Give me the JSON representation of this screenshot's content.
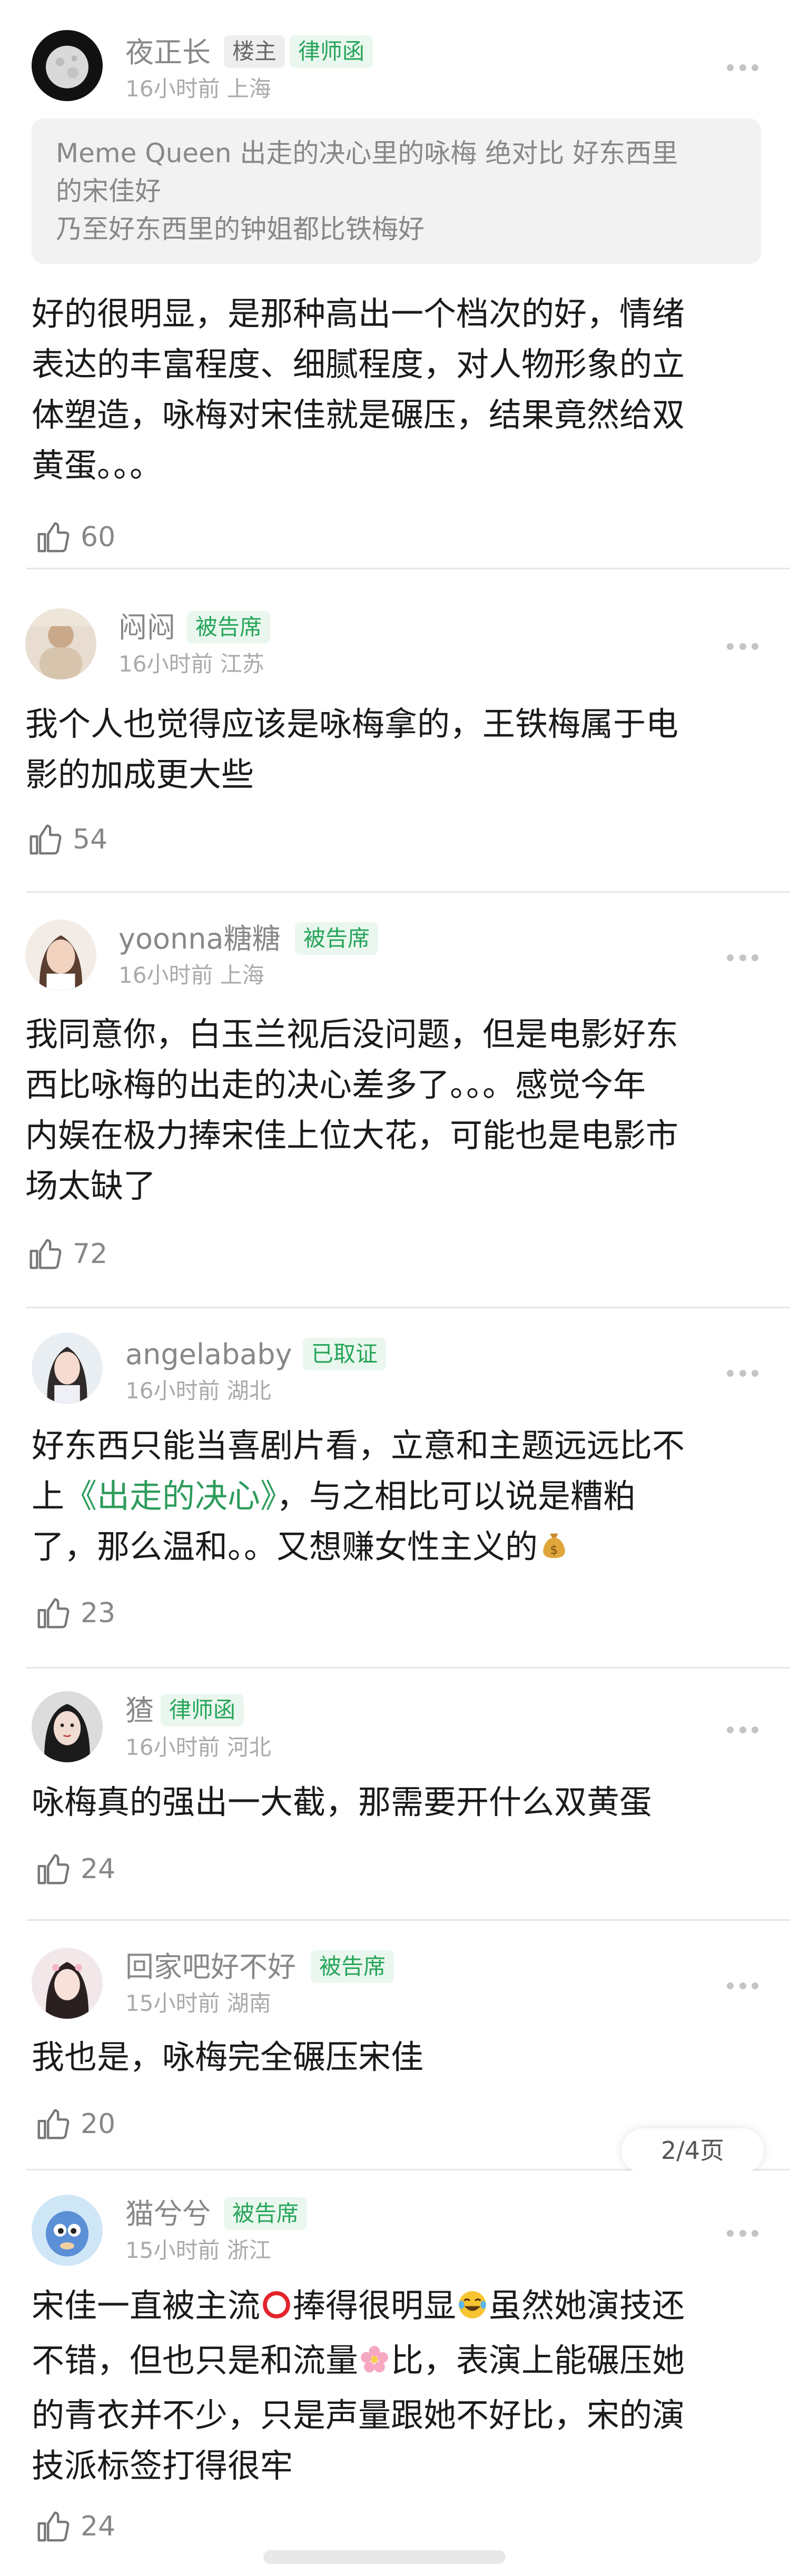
{
  "comments": [
    {
      "name": "夜正长",
      "badges": [
        "楼主",
        "律师函"
      ],
      "meta": "16小时前 上海",
      "quote_lines": [
        "Meme Queen 出走的决心里的咏梅 绝对比 好东西里",
        "的宋佳好",
        "乃至好东西里的钟姐都比铁梅好"
      ],
      "text_lines": [
        "好的很明显，是那种高出一个档次的好，情绪",
        "表达的丰富程度、细腻程度，对人物形象的立",
        "体塑造，咏梅对宋佳就是碾压，结果竟然给双",
        "黄蛋。。。"
      ],
      "likes": "60"
    },
    {
      "name": "闷闷",
      "badges": [
        "被告席"
      ],
      "meta": "16小时前 江苏",
      "text_lines": [
        "我个人也觉得应该是咏梅拿的，王铁梅属于电",
        "影的加成更大些"
      ],
      "likes": "54"
    },
    {
      "name": "yoonna糖糖",
      "badges": [
        "被告席"
      ],
      "meta": "16小时前 上海",
      "text_lines": [
        "我同意你，白玉兰视后没问题，但是电影好东",
        "西比咏梅的出走的决心差多了。。。感觉今年",
        "内娱在极力捧宋佳上位大花，可能也是电影市",
        "场太缺了"
      ],
      "likes": "72"
    },
    {
      "name": "angelababy",
      "badges": [
        "已取证"
      ],
      "meta": "16小时前 湖北",
      "text_lines_parts": [
        [
          {
            "t": "好东西只能当喜剧片看，立意和主题远远比不"
          }
        ],
        [
          {
            "t": "上"
          },
          {
            "t": "《出走的决心》",
            "hl": true
          },
          {
            "t": "，与之相比可以说是糟粕"
          }
        ],
        [
          {
            "t": "了，那么温和。。又想赚女性主义的"
          }
        ]
      ],
      "likes": "23"
    },
    {
      "name": "猹",
      "badges": [
        "律师函"
      ],
      "meta": "16小时前 河北",
      "text_lines": [
        "咏梅真的强出一大截，那需要开什么双黄蛋"
      ],
      "likes": "24"
    },
    {
      "name": "回家吧好不好",
      "badges": [
        "被告席"
      ],
      "meta": "15小时前 湖南",
      "text_lines": [
        "我也是，咏梅完全碾压宋佳"
      ],
      "likes": "20"
    },
    {
      "name": "猫兮兮",
      "badges": [
        "被告席"
      ],
      "meta": "15小时前 浙江",
      "text_lines_parts": [
        [
          {
            "t": "宋佳一直被主流"
          },
          {
            "emoji": "circle"
          },
          {
            "t": "捧得很明显"
          },
          {
            "emoji": "laugh"
          },
          {
            "t": "虽然她演技还"
          }
        ],
        [
          {
            "t": "不错，但也只是和流量"
          },
          {
            "emoji": "flower"
          },
          {
            "t": "比，表演上能碾压她"
          }
        ],
        [
          {
            "t": "的青衣并不少，只是声量跟她不好比，宋的演"
          }
        ],
        [
          {
            "t": "技派标签打得很牢"
          }
        ]
      ],
      "likes": "24"
    }
  ],
  "pager": "2/4页",
  "colors": {
    "badge_green": "#26a55a",
    "badge_bg": "#eaf7ee",
    "highlight": "#2e9c5c"
  }
}
